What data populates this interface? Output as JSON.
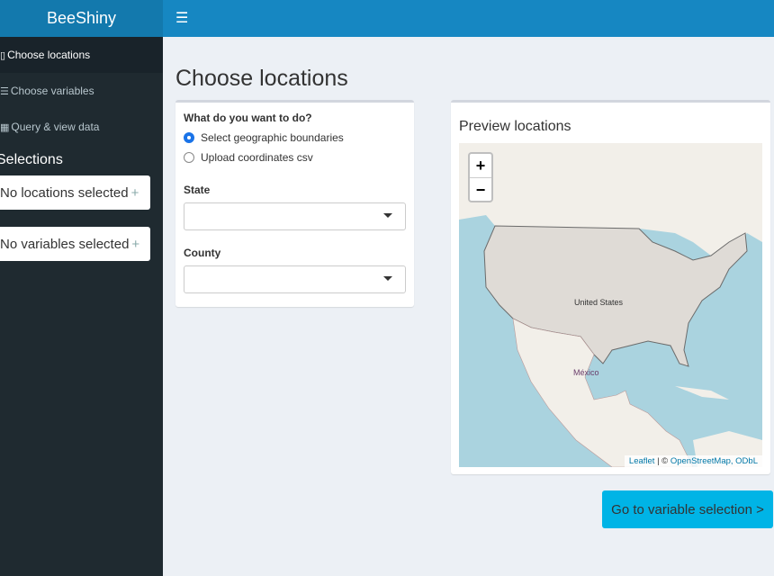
{
  "app": {
    "title": "BeeShiny",
    "menu_icon": "hamburger-icon"
  },
  "sidebar": {
    "items": [
      {
        "label": "Choose locations",
        "icon": "map-icon",
        "active": true
      },
      {
        "label": "Choose variables",
        "icon": "database-icon",
        "active": false
      },
      {
        "label": "Query & view data",
        "icon": "table-icon",
        "active": false
      }
    ],
    "selections_title": "Selections",
    "locations": "No locations selected",
    "variables": "No variables selected",
    "plus": "+"
  },
  "main": {
    "title": "Choose locations",
    "form": {
      "question": "What do you want to do?",
      "options": [
        "Select geographic boundaries",
        "Upload coordinates csv"
      ],
      "selected": 0,
      "state_label": "State",
      "state_value": "",
      "county_label": "County",
      "county_value": ""
    },
    "preview": {
      "title": "Preview locations",
      "zoom_in": "+",
      "zoom_out": "−",
      "labels": {
        "us": "United States",
        "mx": "México"
      },
      "attribution": {
        "leaflet": "Leaflet",
        "sep": " | © ",
        "osm": "OpenStreetMap, ODbL"
      }
    },
    "next_button": "Go to variable selection >"
  }
}
